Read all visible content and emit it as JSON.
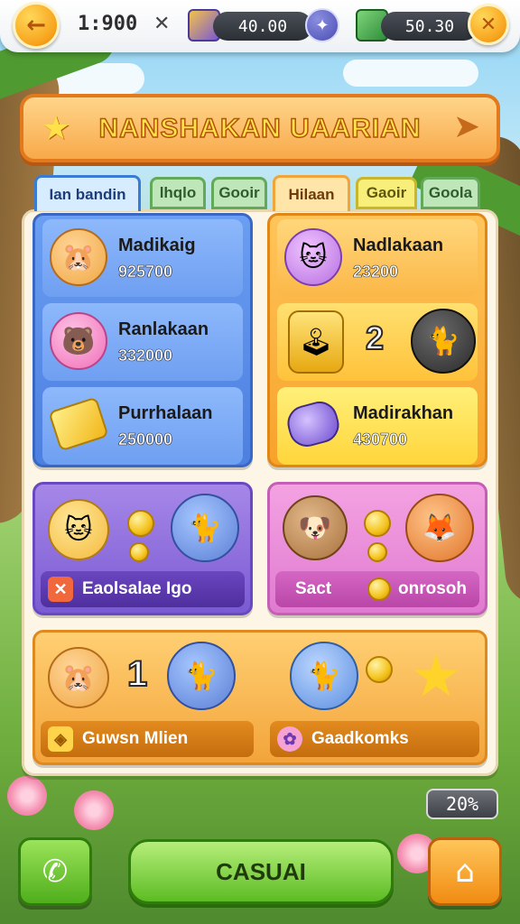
{
  "status_bar": {
    "time": "1:900",
    "close_glyph": "✕",
    "currency_1": "40.00",
    "currency_2": "50.30"
  },
  "banner": {
    "title": "NANSHAKAN UAARIAN"
  },
  "tabs": [
    {
      "label": "Ian bandin",
      "active": true
    },
    {
      "label": "lhqlo"
    },
    {
      "label": "Gooir"
    },
    {
      "label": "Hilaan",
      "active": true
    },
    {
      "label": "Gaoir"
    },
    {
      "label": "Goola"
    }
  ],
  "left_list": [
    {
      "name": "Madikaig",
      "value": "925700",
      "icon": "hamster-icon"
    },
    {
      "name": "Ranlakaan",
      "value": "332000",
      "icon": "pink-bear-icon"
    },
    {
      "name": "Purrhalaan",
      "value": "250000",
      "icon": "gold-bar-icon"
    }
  ],
  "right_list": [
    {
      "name": "Nadlakaan",
      "value": "23200",
      "icon": "purple-cat-icon"
    },
    {
      "name": "",
      "value": "2",
      "icon": "joystick-trophy-icon"
    },
    {
      "name": "Madirakhan",
      "value": "430700",
      "icon": "purple-gem-icon"
    }
  ],
  "promo_cards": [
    {
      "label": "Eaolsalae Igo",
      "icon": "close-x-icon"
    },
    {
      "label_left": "Sact",
      "label_right": "onrosoh",
      "icon": "coin-icon"
    }
  ],
  "bottom_card": {
    "big_number": "1",
    "label_left": "Guwsn Mlien",
    "label_right": "Gaadkomks"
  },
  "percent_badge": "20%",
  "buttons": {
    "casual": "CASUAI",
    "phone_icon": "✆",
    "home_icon": "⌂"
  },
  "colors": {
    "accent_orange": "#f7a21b",
    "primary_green": "#5cbc24",
    "panel_bg": "#fdf6e6"
  }
}
